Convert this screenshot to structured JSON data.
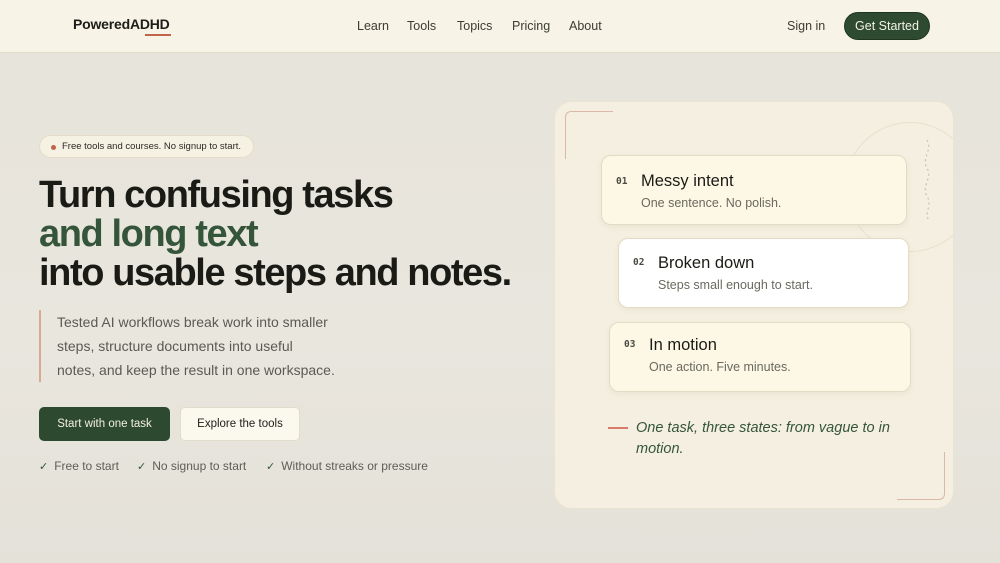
{
  "header": {
    "logo_prefix": "Powered",
    "logo_suffix": "ADHD",
    "nav": [
      "Learn",
      "Tools",
      "Topics",
      "Pricing",
      "About"
    ],
    "sign_in": "Sign in",
    "cta": "Get Started"
  },
  "hero": {
    "pill": "Free tools and courses. No signup to start.",
    "headline_l1": "Turn confusing tasks",
    "headline_l2": "and long text",
    "headline_l3": "into usable steps and notes.",
    "lede_lines": [
      "Tested AI workflows break work into smaller",
      "steps, structure documents into useful",
      "notes, and keep the result in one workspace."
    ],
    "primary_button": "Start with one task",
    "secondary_button": "Explore the tools",
    "checks": [
      "Free to start",
      "No signup to start",
      "Without streaks or pressure"
    ]
  },
  "panel": {
    "cards": [
      {
        "num": "01",
        "title": "Messy intent",
        "sub": "One sentence. No polish."
      },
      {
        "num": "02",
        "title": "Broken down",
        "sub": "Steps small enough to start."
      },
      {
        "num": "03",
        "title": "In motion",
        "sub": "One action. Five minutes."
      }
    ],
    "caption": "One task, three states: from vague to in motion."
  },
  "colors": {
    "accent_green": "#2e4a30",
    "accent_orange": "#c0644c",
    "header_bg": "#f7f3e6",
    "panel_bg": "#f4efe0"
  }
}
